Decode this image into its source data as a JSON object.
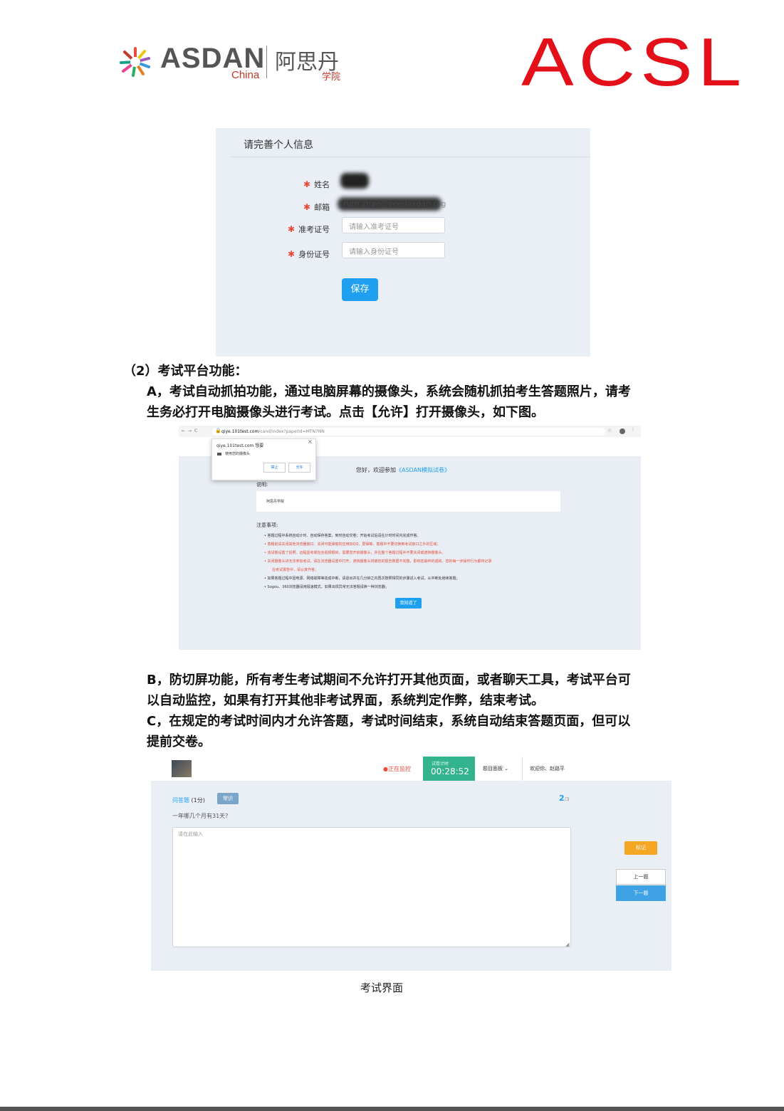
{
  "header": {
    "asdan_word": "ASDAN",
    "asdan_sub": "China",
    "asdan_cn": "阿思丹",
    "asdan_cn_sub": "学院",
    "acsl_logo": "ACSL"
  },
  "form": {
    "title": "请完善个人信息",
    "name_label": "姓名",
    "email_label": "邮箱",
    "email_value": "ruth.zhao@seedasdan.org",
    "ticket_label": "准考证号",
    "ticket_placeholder": "请输入准考证号",
    "id_label": "身份证号",
    "id_placeholder": "请输入身份证号",
    "save": "保存",
    "required": "✱"
  },
  "section": {
    "heading": "（2）考试平台功能：",
    "a_line1": "A，考试自动抓拍功能，通过电脑屏幕的摄像头，系统会随机抓拍考生答题照片，请考",
    "a_line2": "生务必打开电脑摄像头进行考试。点击【允许】打开摄像头，如下图。",
    "b_line1": "B，防切屏功能，所有考生考试期间不允许打开其他页面，或者聊天工具，考试平台可",
    "b_line2": "以自动监控，如果有打开其他非考试界面，系统判定作弊，结束考试。",
    "c_line1": "C，在规定的考试时间内才允许答题，考试时间结束，系统自动结束答题页面，但可以",
    "c_line2": "提前交卷。",
    "caption": "考试界面"
  },
  "browser": {
    "url_host": "qiye.101test.com",
    "url_path": "/cand/index?paperId=MTN7NN",
    "popup_title": "qiye.101test.com 想要",
    "popup_item": "使用您的摄像头",
    "block": "禁止",
    "allow": "允许",
    "welcome": "您好，欢迎参加",
    "exam_name": "《ASDAN模拟试卷》",
    "desc_label": "说明:",
    "desc_text": "阿思丹学院",
    "notes_label": "注意事项:",
    "rules": [
      "答题过程中系统自动计时、自动保存答案，到时自动交卷；开始考试后请在计时时间内完成作答。",
      "答题前请关闭其他浏览器窗口、关闭可能弹窗的应用如QQ、屏保等，答题中不要切换到考试窗口之外的区域；",
      "该试卷设置了拍照、远程监考或包含视频题目，需要您开启摄像头，并在整个答题过程中不要关闭或遮挡摄像头。",
      "关闭摄像头讲无法参加考试，请在浏览器设置中打开。遮挡摄像头将被您的报告数据不完整，影响您最终的成绩。您的每一步操作行为都将记录",
      "在考试报告中，请认真作答。",
      "如果答题过程中因电源、网络故障等造成中断，请退出并在几分钟之内再次按照相同的步骤进入考试，从中断处继续答题；",
      "Sogou、360浏览器请用极速模式，如果出现异常无法答题请换一种浏览器；"
    ],
    "ok": "我知道了"
  },
  "exam": {
    "monitor": "正在监控",
    "timer_label": "试卷计时",
    "timer_value": "00:28:52",
    "panel_menu": "题目面板",
    "welcome_user": "欢迎你、赵路平",
    "q_type": "问答题",
    "q_score": "(1分)",
    "q_tag": "常识",
    "q_num": "2",
    "q_total": "/3",
    "question": "一年哪几个月有31天?",
    "answer_placeholder": "请在此输入",
    "mark": "标记",
    "prev": "上一题",
    "next": "下一题"
  },
  "colors": {
    "acsl_red": "#e3101a",
    "primary_blue": "#1e9ff0",
    "timer_green": "#34b48e",
    "mark_orange": "#f5a623"
  }
}
